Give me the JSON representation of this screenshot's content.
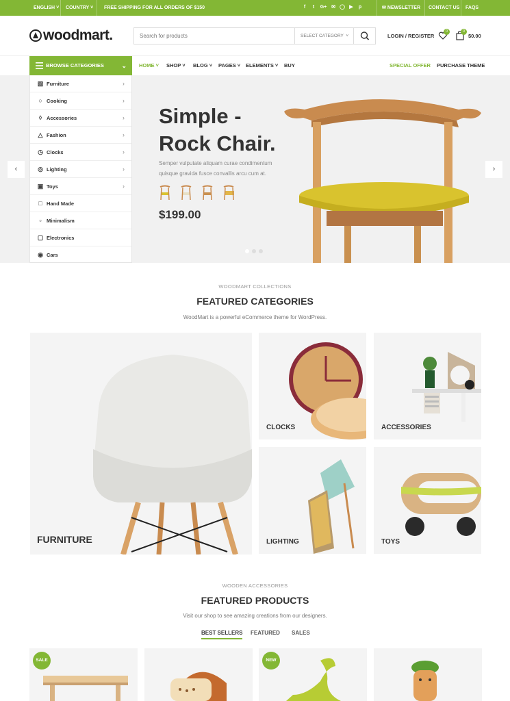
{
  "topbar": {
    "language": "ENGLISH",
    "country": "COUNTRY",
    "shipping": "FREE SHIPPING FOR ALL ORDERS OF $150",
    "newsletter": "NEWSLETTER",
    "contact": "CONTACT US",
    "faqs": "FAQS",
    "social_icons": [
      "facebook-icon",
      "twitter-icon",
      "google-plus-icon",
      "email-icon",
      "instagram-icon",
      "youtube-icon",
      "pinterest-icon"
    ]
  },
  "header": {
    "logo": "woodmart.",
    "search_placeholder": "Search for products",
    "select_category": "SELECT CATEGORY",
    "login": "LOGIN / REGISTER",
    "wishlist_count": "0",
    "cart_count": "0",
    "cart_total": "$0.00"
  },
  "nav": {
    "browse": "BROWSE CATEGORIES",
    "items": [
      "HOME",
      "SHOP",
      "BLOG",
      "PAGES",
      "ELEMENTS",
      "BUY"
    ],
    "special_offer": "SPECIAL OFFER",
    "purchase": "PURCHASE THEME"
  },
  "categories_menu": [
    {
      "label": "Furniture",
      "icon": "chair-icon"
    },
    {
      "label": "Cooking",
      "icon": "pan-icon"
    },
    {
      "label": "Accessories",
      "icon": "accessories-icon"
    },
    {
      "label": "Fashion",
      "icon": "shirt-icon"
    },
    {
      "label": "Clocks",
      "icon": "clock-icon"
    },
    {
      "label": "Lighting",
      "icon": "bulb-icon"
    },
    {
      "label": "Toys",
      "icon": "toy-icon"
    },
    {
      "label": "Hand Made",
      "icon": "hand-icon"
    },
    {
      "label": "Minimalism",
      "icon": "minimal-icon"
    },
    {
      "label": "Electronics",
      "icon": "electronics-icon"
    },
    {
      "label": "Cars",
      "icon": "car-icon"
    }
  ],
  "hero": {
    "title_line1": "Simple -",
    "title_line2": "Rock Chair.",
    "description": "Semper vulputate aliquam curae condimentum quisque gravida fusce convallis arcu cum at.",
    "price": "$199.00",
    "accent_color": "#83b735",
    "seat_color": "#d9c32e"
  },
  "featured_categories": {
    "eyebrow": "WOODMART COLLECTIONS",
    "title": "FEATURED CATEGORIES",
    "description": "WoodMart is a powerful eCommerce theme for WordPress.",
    "cards": [
      "FURNITURE",
      "CLOCKS",
      "ACCESSORIES",
      "LIGHTING",
      "TOYS"
    ]
  },
  "featured_products": {
    "eyebrow": "WOODEN ACCESSORIES",
    "title": "FEATURED PRODUCTS",
    "description": "Visit our shop to see amazing creations from our designers.",
    "tabs": [
      "BEST SELLERS",
      "FEATURED",
      "SALES"
    ],
    "badges": {
      "sale": "SALE",
      "new": "NEW"
    }
  }
}
